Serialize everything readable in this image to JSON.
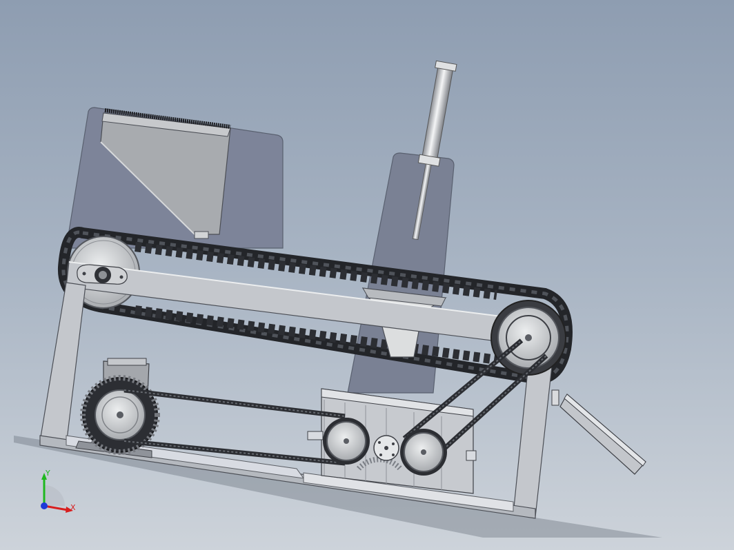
{
  "triad": {
    "x_label": "X",
    "y_label": "Y",
    "x_color": "#d81e1e",
    "y_color": "#1eb81e",
    "z_color": "#1e3ad8"
  },
  "colors": {
    "background_top": "#8e9db1",
    "background_bottom": "#cdd3da",
    "plate": "#7d8499",
    "frame_metal": "#c4c7cc",
    "belt": "#2a2c30",
    "pulley": "#d2d4d6"
  },
  "parts": [
    "back-plate-left",
    "back-plate-right",
    "feed-hopper",
    "air-cylinder",
    "conveyor-belt",
    "drive-pulley",
    "idler-pulley",
    "frame",
    "motor",
    "gearbox",
    "discharge-chute"
  ]
}
